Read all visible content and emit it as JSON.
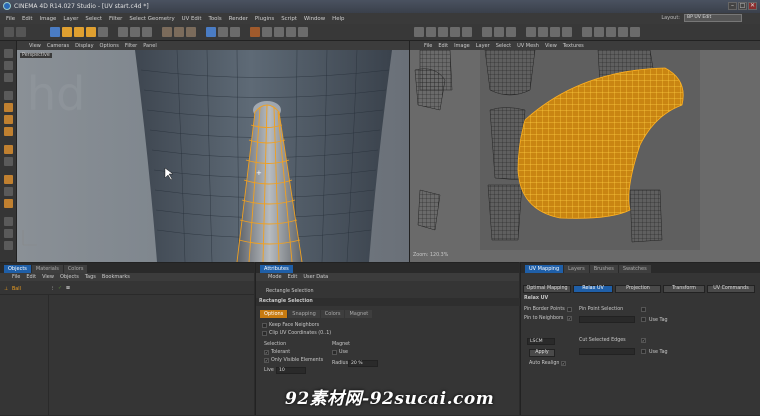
{
  "window": {
    "title": "CINEMA 4D R14.027 Studio - [UV start.c4d *]",
    "min": "–",
    "max": "□",
    "close": "✕"
  },
  "menu": [
    "File",
    "Edit",
    "Image",
    "Layer",
    "Select",
    "Filter",
    "Select Geometry",
    "UV Edit",
    "Tools",
    "Render",
    "Plugins",
    "Script",
    "Window",
    "Help"
  ],
  "layout": {
    "label": "Layout:",
    "value": "BP UV Edit"
  },
  "viewport1": {
    "menu": [
      "View",
      "Cameras",
      "Display",
      "Options",
      "Filter",
      "Panel"
    ],
    "label": "Perspective"
  },
  "viewport2": {
    "menu": [
      "File",
      "Edit",
      "Image",
      "Layer",
      "Select",
      "UV Mesh",
      "View",
      "Textures"
    ],
    "zoom": "Zoom: 120.3%"
  },
  "objects": {
    "tabs": [
      "Objects",
      "Materials",
      "Colors"
    ],
    "menu": [
      "File",
      "Edit",
      "View",
      "Objects",
      "Tags",
      "Bookmarks"
    ],
    "item": "Ball"
  },
  "attributes": {
    "tab": "Attributes",
    "menu": [
      "Mode",
      "Edit",
      "User Data"
    ],
    "tool": "Rectangle Selection",
    "heading": "Rectangle Selection",
    "subtabs": [
      "Options",
      "Snapping",
      "Colors",
      "Magnet"
    ],
    "keep_face": "Keep Face Neighbors",
    "clip_uv": "Clip UV Coordinates (0..1)",
    "selection_label": "Selection",
    "tolerant": "Tolerant",
    "only_visible": "Only Visible Elements",
    "live_label": "Live",
    "live_value": "10",
    "magnet_label": "Magnet",
    "use": "Use",
    "radius_label": "Radius",
    "radius_value": "20 %"
  },
  "uvpanel": {
    "tabs": [
      "UV Mapping",
      "Layers",
      "Brushes",
      "Swatches"
    ],
    "subtabs": [
      "Optimal Mapping",
      "Relax UV",
      "Projection",
      "Transform",
      "UV Commands"
    ],
    "heading": "Relax UV",
    "pin_border": "Pin Border Points",
    "pin_point": "Pin Point Selection",
    "pin_neighbors": "Pin to Neighbors",
    "use_tag": "Use Tag",
    "lscm": "LSCM",
    "cut_edges": "Cut Selected Edges",
    "use_tag2": "Use Tag",
    "apply": "Apply",
    "auto_realign": "Auto Realign"
  },
  "watermark": "92素材网-92sucai.com",
  "colors": {
    "accent": "#1f5fa8",
    "wire": "#f0a020"
  }
}
